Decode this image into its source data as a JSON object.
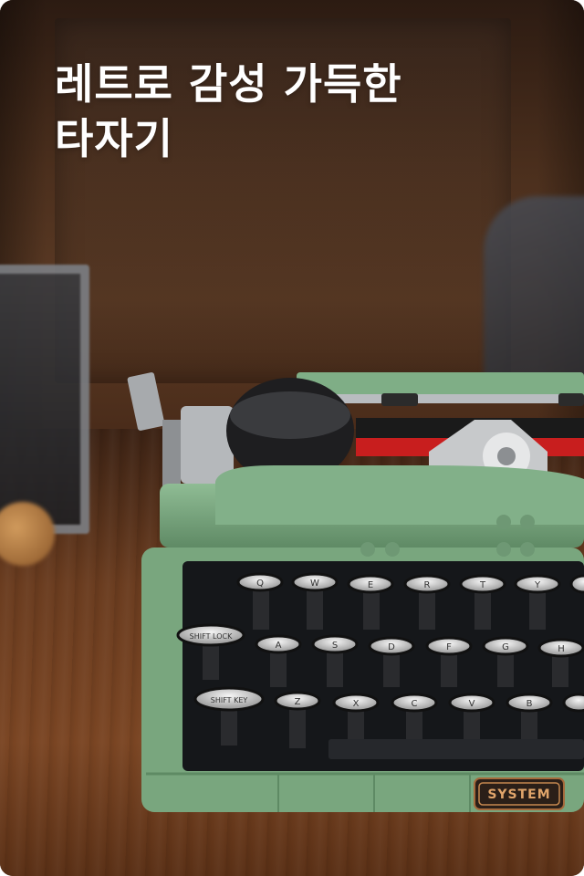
{
  "headline": {
    "line1": "레트로 감성 가득한",
    "line2": "타자기"
  },
  "typewriter": {
    "brand_plate": "SYSTEM",
    "keys_row1": [
      "Q",
      "W",
      "E",
      "R",
      "T",
      "Y",
      ""
    ],
    "keys_row2": [
      "SHIFT LOCK",
      "A",
      "S",
      "D",
      "F",
      "G",
      "H"
    ],
    "keys_row3": [
      "SHIFT KEY",
      "Z",
      "X",
      "C",
      "V",
      "B",
      ""
    ]
  },
  "colors": {
    "body_green": "#79a67e",
    "ribbon_red": "#c81e1e",
    "wood": "#6a3c1f"
  }
}
